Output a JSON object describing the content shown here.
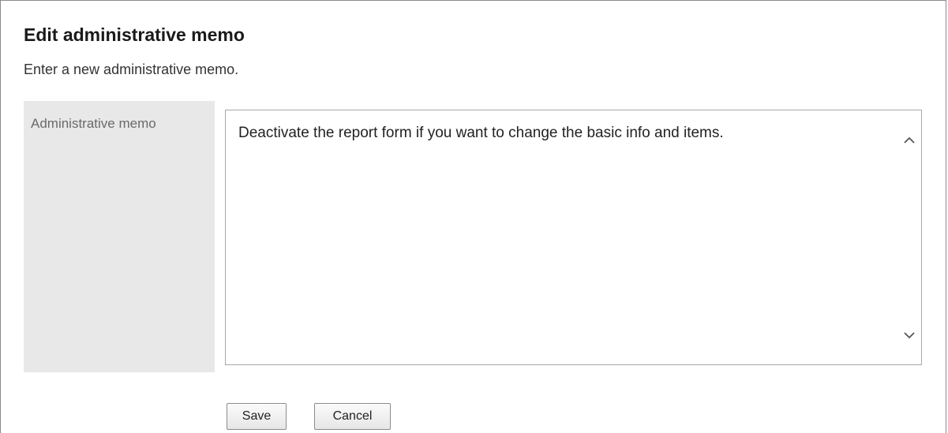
{
  "dialog": {
    "title": "Edit administrative memo",
    "description": "Enter a new administrative memo."
  },
  "form": {
    "memo_label": "Administrative memo",
    "memo_value": "Deactivate the report form if you want to change the basic info and items."
  },
  "scrollbar": {
    "up_icon": "chevron-up-icon",
    "down_icon": "chevron-down-icon"
  },
  "actions": {
    "save_label": "Save",
    "cancel_label": "Cancel"
  }
}
